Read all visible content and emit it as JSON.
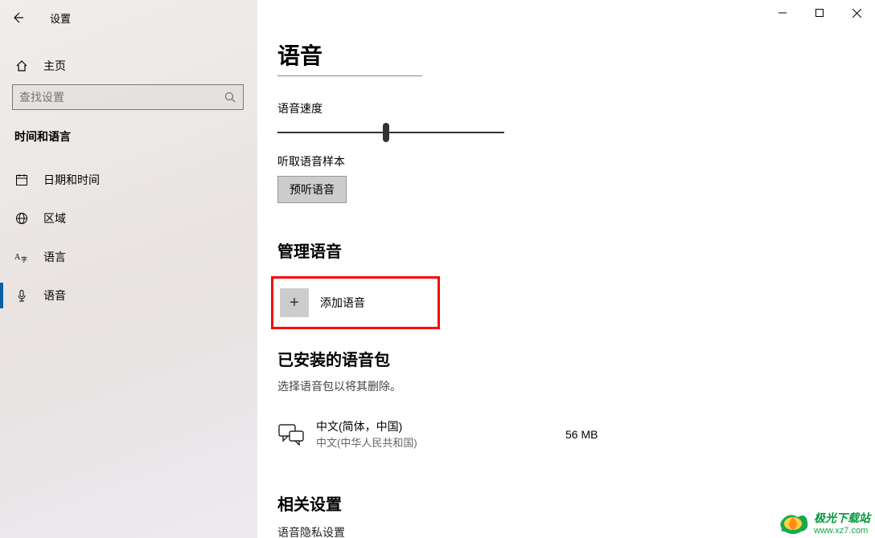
{
  "window": {
    "title": "设置"
  },
  "sidebar": {
    "home": "主页",
    "search_placeholder": "查找设置",
    "category": "时间和语言",
    "items": [
      {
        "label": "日期和时间"
      },
      {
        "label": "区域"
      },
      {
        "label": "语言"
      },
      {
        "label": "语音"
      }
    ]
  },
  "page": {
    "heading": "语音",
    "speed_label": "语音速度",
    "sample_label": "听取语音样本",
    "preview_btn": "预听语音",
    "manage_heading": "管理语音",
    "add_voice": "添加语音",
    "installed_heading": "已安装的语音包",
    "installed_desc": "选择语音包以将其删除。",
    "pack": {
      "name": "中文(简体，中国)",
      "sub": "中文(中华人民共和国)",
      "size": "56 MB"
    },
    "related_heading": "相关设置",
    "related_link": "语音隐私设置"
  },
  "watermark": {
    "line1": "极光下载站",
    "line2": "www.xz7.com"
  }
}
